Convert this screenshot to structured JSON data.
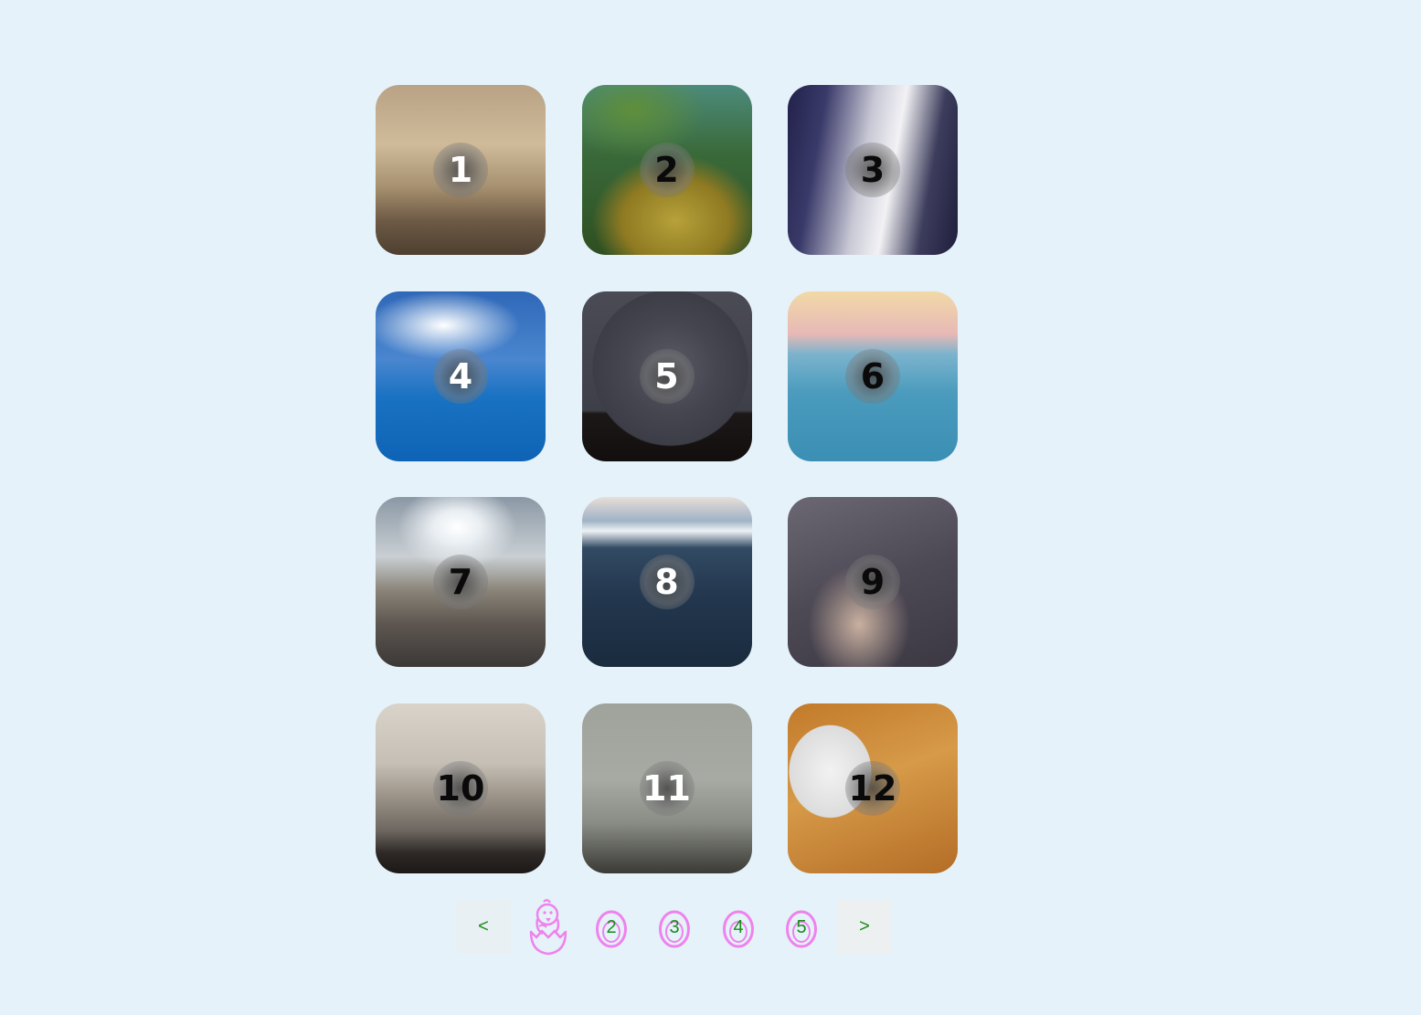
{
  "gallery": {
    "tiles": [
      {
        "label": "1"
      },
      {
        "label": "2"
      },
      {
        "label": "3"
      },
      {
        "label": "4"
      },
      {
        "label": "5"
      },
      {
        "label": "6"
      },
      {
        "label": "7"
      },
      {
        "label": "8"
      },
      {
        "label": "9"
      },
      {
        "label": "10"
      },
      {
        "label": "11"
      },
      {
        "label": "12"
      }
    ]
  },
  "pagination": {
    "prev_label": "<",
    "next_label": ">",
    "current_page_icon": "hatching-chick-icon",
    "page_icon": "egg-icon",
    "pages": [
      "2",
      "3",
      "4",
      "5"
    ],
    "accent_color": "#ee82ee",
    "text_color": "#1a8a1a"
  },
  "colors": {
    "background": "#e5f2f9"
  }
}
